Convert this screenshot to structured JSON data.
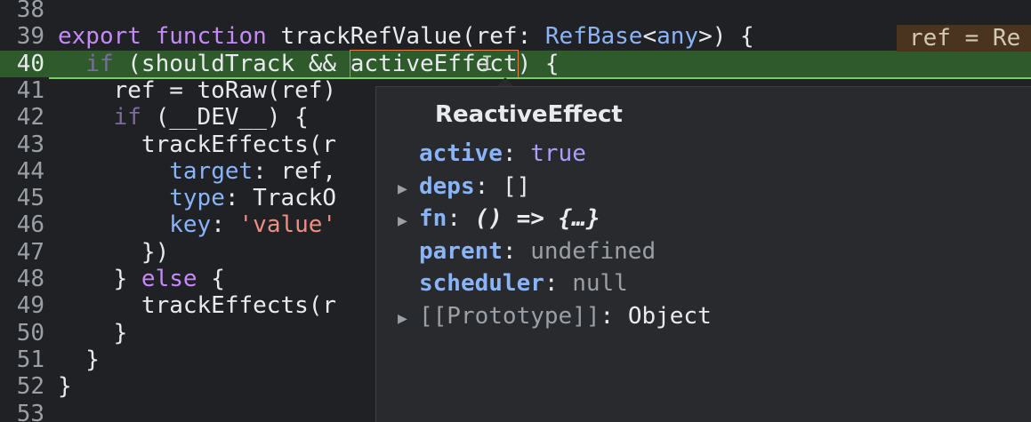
{
  "editor": {
    "lines": [
      {
        "num": "38",
        "tokens": []
      },
      {
        "num": "39",
        "tokens": [
          {
            "t": "export",
            "c": "kw"
          },
          {
            "t": " "
          },
          {
            "t": "function",
            "c": "kw"
          },
          {
            "t": " trackRefValue(ref: "
          },
          {
            "t": "RefBase",
            "c": "ty"
          },
          {
            "t": "<"
          },
          {
            "t": "any",
            "c": "ty"
          },
          {
            "t": ">) {"
          }
        ]
      },
      {
        "num": "40",
        "tokens": [
          {
            "t": "  "
          },
          {
            "t": "if",
            "c": "kwd"
          },
          {
            "t": " (shouldTrack && "
          },
          {
            "t": "activeEffect",
            "c": "word-hl"
          },
          {
            "t": ") {"
          }
        ]
      },
      {
        "num": "41",
        "tokens": [
          {
            "t": "    ref = toRaw(ref)"
          }
        ]
      },
      {
        "num": "42",
        "tokens": [
          {
            "t": "    "
          },
          {
            "t": "if",
            "c": "kwd"
          },
          {
            "t": " (__DEV__) {"
          }
        ]
      },
      {
        "num": "43",
        "tokens": [
          {
            "t": "      trackEffects(r"
          }
        ]
      },
      {
        "num": "44",
        "tokens": [
          {
            "t": "        "
          },
          {
            "t": "target",
            "c": "prop"
          },
          {
            "t": ": ref,"
          }
        ]
      },
      {
        "num": "45",
        "tokens": [
          {
            "t": "        "
          },
          {
            "t": "type",
            "c": "prop"
          },
          {
            "t": ": TrackO"
          }
        ]
      },
      {
        "num": "46",
        "tokens": [
          {
            "t": "        "
          },
          {
            "t": "key",
            "c": "prop"
          },
          {
            "t": ": "
          },
          {
            "t": "'value'",
            "c": "str"
          }
        ]
      },
      {
        "num": "47",
        "tokens": [
          {
            "t": "      })"
          }
        ]
      },
      {
        "num": "48",
        "tokens": [
          {
            "t": "    } "
          },
          {
            "t": "else",
            "c": "kw"
          },
          {
            "t": " {"
          }
        ]
      },
      {
        "num": "49",
        "tokens": [
          {
            "t": "      trackEffects(r"
          }
        ]
      },
      {
        "num": "50",
        "tokens": [
          {
            "t": "    }"
          }
        ]
      },
      {
        "num": "51",
        "tokens": [
          {
            "t": "  }"
          }
        ]
      },
      {
        "num": "52",
        "tokens": [
          {
            "t": "}"
          }
        ]
      },
      {
        "num": "53",
        "tokens": []
      }
    ],
    "inline_preview": "ref = Re"
  },
  "popover": {
    "title": "ReactiveEffect",
    "properties": [
      {
        "expandable": false,
        "key": "active",
        "sep": ": ",
        "value": "true",
        "vclass": "pval-bool"
      },
      {
        "expandable": true,
        "key": "deps",
        "sep": ": ",
        "value": "[]",
        "vclass": "pval-plain"
      },
      {
        "expandable": true,
        "key": "fn",
        "sep": ": ",
        "value": "() => {…}",
        "vclass": "pval-fn"
      },
      {
        "expandable": false,
        "key": "parent",
        "sep": ": ",
        "value": "undefined",
        "vclass": "pval-muted"
      },
      {
        "expandable": false,
        "key": "scheduler",
        "sep": ": ",
        "value": "null",
        "vclass": "pval-muted"
      },
      {
        "expandable": true,
        "key": "[[Prototype]]",
        "sep": ": ",
        "value": "Object",
        "vclass": "pval-plain",
        "proto": true
      }
    ]
  },
  "icons": {
    "expand": "triangle-right-icon",
    "cursor": "text-cursor-icon"
  }
}
